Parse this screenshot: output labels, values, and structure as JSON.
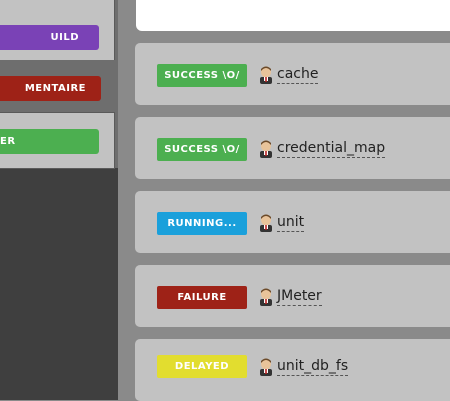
{
  "sidebar": {
    "items": [
      {
        "label": "UILD",
        "color": "#7a42b6"
      },
      {
        "label": "MENTAIRE",
        "color": "#9e2217"
      },
      {
        "label": "ER",
        "color": "#4caf50"
      }
    ]
  },
  "jobs": [
    {
      "status": "SUCCESS \\O/",
      "status_kind": "success",
      "name": "cache",
      "avatar": "jenkins-avatar-icon"
    },
    {
      "status": "SUCCESS \\O/",
      "status_kind": "success",
      "name": "credential_map",
      "avatar": "jenkins-avatar-icon"
    },
    {
      "status": "RUNNING...",
      "status_kind": "running",
      "name": "unit",
      "avatar": "jenkins-avatar-icon"
    },
    {
      "status": "FAILURE",
      "status_kind": "failure",
      "name": "JMeter",
      "avatar": "jenkins-avatar-icon"
    },
    {
      "status": "DELAYED",
      "status_kind": "delayed",
      "name": "unit_db_fs",
      "avatar": "jenkins-avatar-icon"
    }
  ],
  "colors": {
    "success": "#4caf50",
    "running": "#1aa0db",
    "failure": "#9e2217",
    "delayed": "#e2dd2f",
    "purple": "#7a42b6"
  }
}
